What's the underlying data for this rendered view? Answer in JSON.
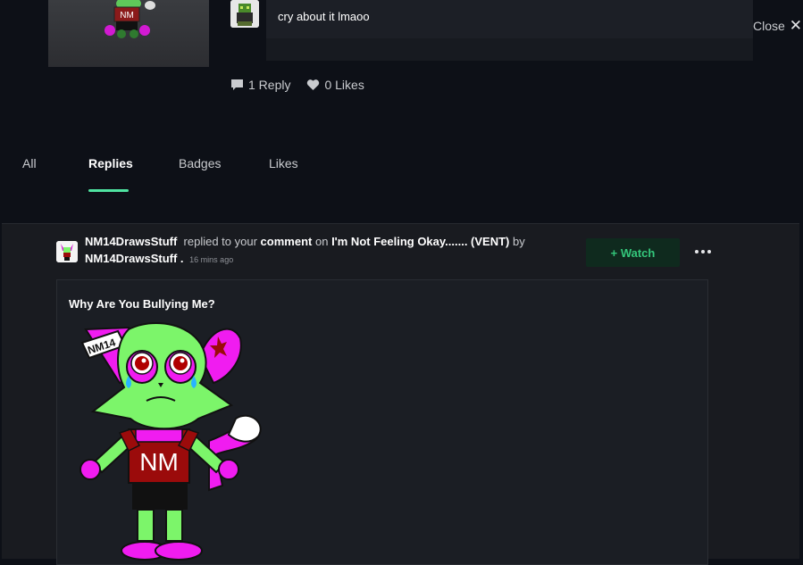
{
  "top": {
    "thumb_label": "NM",
    "comment_text": "cry about it lmaoo",
    "close_label": "Close",
    "close_icon": "close-icon",
    "reply_count": "1 Reply",
    "like_count": "0 Likes"
  },
  "tabs": [
    {
      "label": "All"
    },
    {
      "label": "Replies"
    },
    {
      "label": "Badges"
    },
    {
      "label": "Likes"
    }
  ],
  "active_tab": "Replies",
  "notification": {
    "author": "NM14DrawsStuff",
    "action_text": "replied to your",
    "object_type": "comment",
    "preposition": "on",
    "post_title": "I'm Not Feeling Okay....... (VENT)",
    "by_text": "by",
    "post_author": "NM14DrawsStuff",
    "separator": ".",
    "time_ago": "16 mins ago",
    "watch_label": "+ Watch",
    "reply_text": "Why Are You Bullying Me?",
    "art_text_band": "NM14",
    "art_text_shirt": "NM"
  },
  "colors": {
    "background": "#0d1017",
    "panel": "#191b20",
    "accent_green": "#4fe3a1",
    "watch_text": "#34c77b",
    "character_green": "#7cf56a",
    "character_magenta": "#f01cf0",
    "shirt_red": "#9b0b0b"
  }
}
